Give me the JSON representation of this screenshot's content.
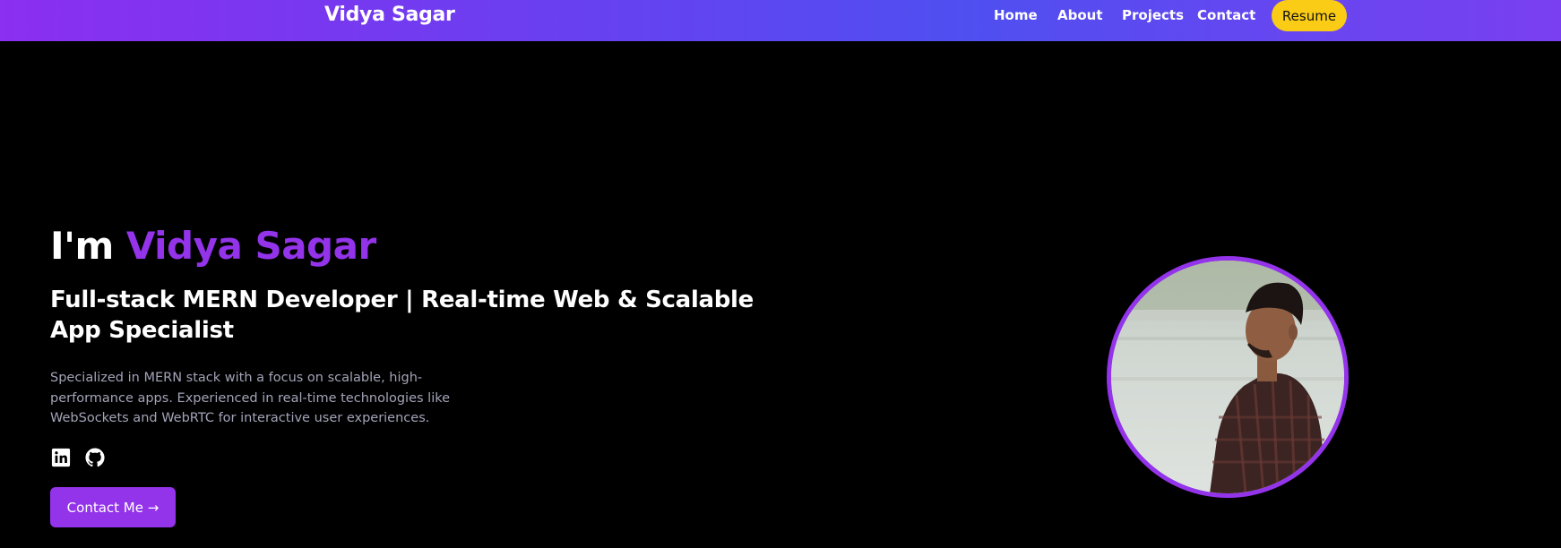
{
  "navbar": {
    "brand": "Vidya Sagar",
    "links": [
      "Home",
      "About",
      "Projects",
      "Contact"
    ],
    "resume_label": "Resume"
  },
  "hero": {
    "greeting": "I'm",
    "name": "Vidya Sagar",
    "subtitle": "Full-stack MERN Developer | Real-time Web & Scalable App Specialist",
    "description": "Specialized in MERN stack with a focus on scalable, high-performance apps. Experienced in real-time technologies like WebSockets and WebRTC for interactive user experiences.",
    "social_icons": [
      "linkedin-icon",
      "github-icon"
    ],
    "contact_label": "Contact Me →"
  },
  "colors": {
    "accent": "#9333ea",
    "resume_button": "#facc15",
    "background": "#000000"
  }
}
